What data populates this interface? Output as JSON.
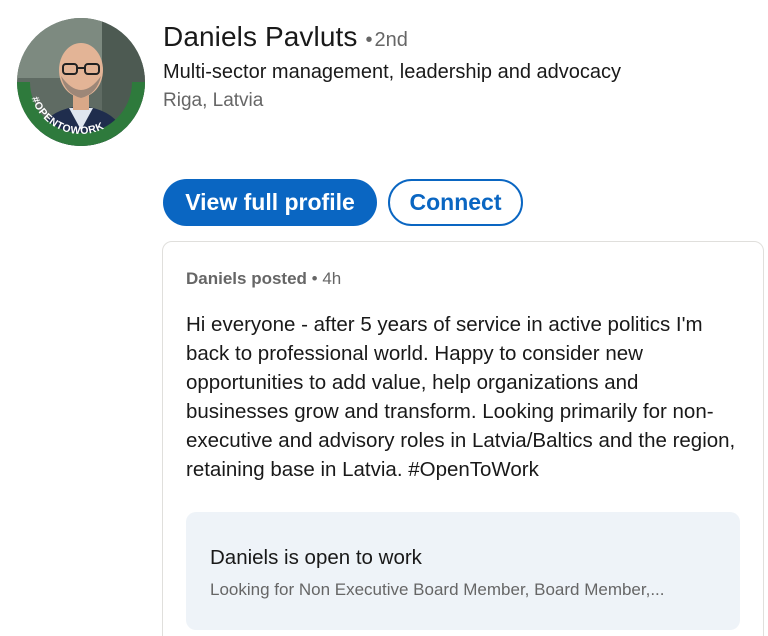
{
  "profile": {
    "name": "Daniels Pavluts",
    "separator": "•",
    "degree": "2nd",
    "headline": "Multi-sector management, leadership and advocacy",
    "location": "Riga, Latvia",
    "avatar_badge": "#OPENTOWORK"
  },
  "actions": {
    "view_profile_label": "View full profile",
    "connect_label": "Connect"
  },
  "post": {
    "author": "Daniels posted",
    "separator": "•",
    "time": "4h",
    "lines": [
      "Hi everyone - after 5 years of service in active politics I'm",
      "back to professional world. Happy to consider new",
      "opportunities to add value, help organizations and",
      "businesses grow and transform. Looking primarily for non-",
      "executive and advisory roles in Latvia/Baltics and the region,",
      "retaining base in Latvia. #OpenToWork"
    ]
  },
  "open_to_work": {
    "title": "Daniels is open to work",
    "subtitle": "Looking for Non Executive Board Member, Board Member,..."
  },
  "colors": {
    "primary": "#0a66c2",
    "badge_green": "#2e7a3c",
    "panel_bg": "#eef3f8",
    "text": "#191919",
    "muted": "#666666"
  }
}
